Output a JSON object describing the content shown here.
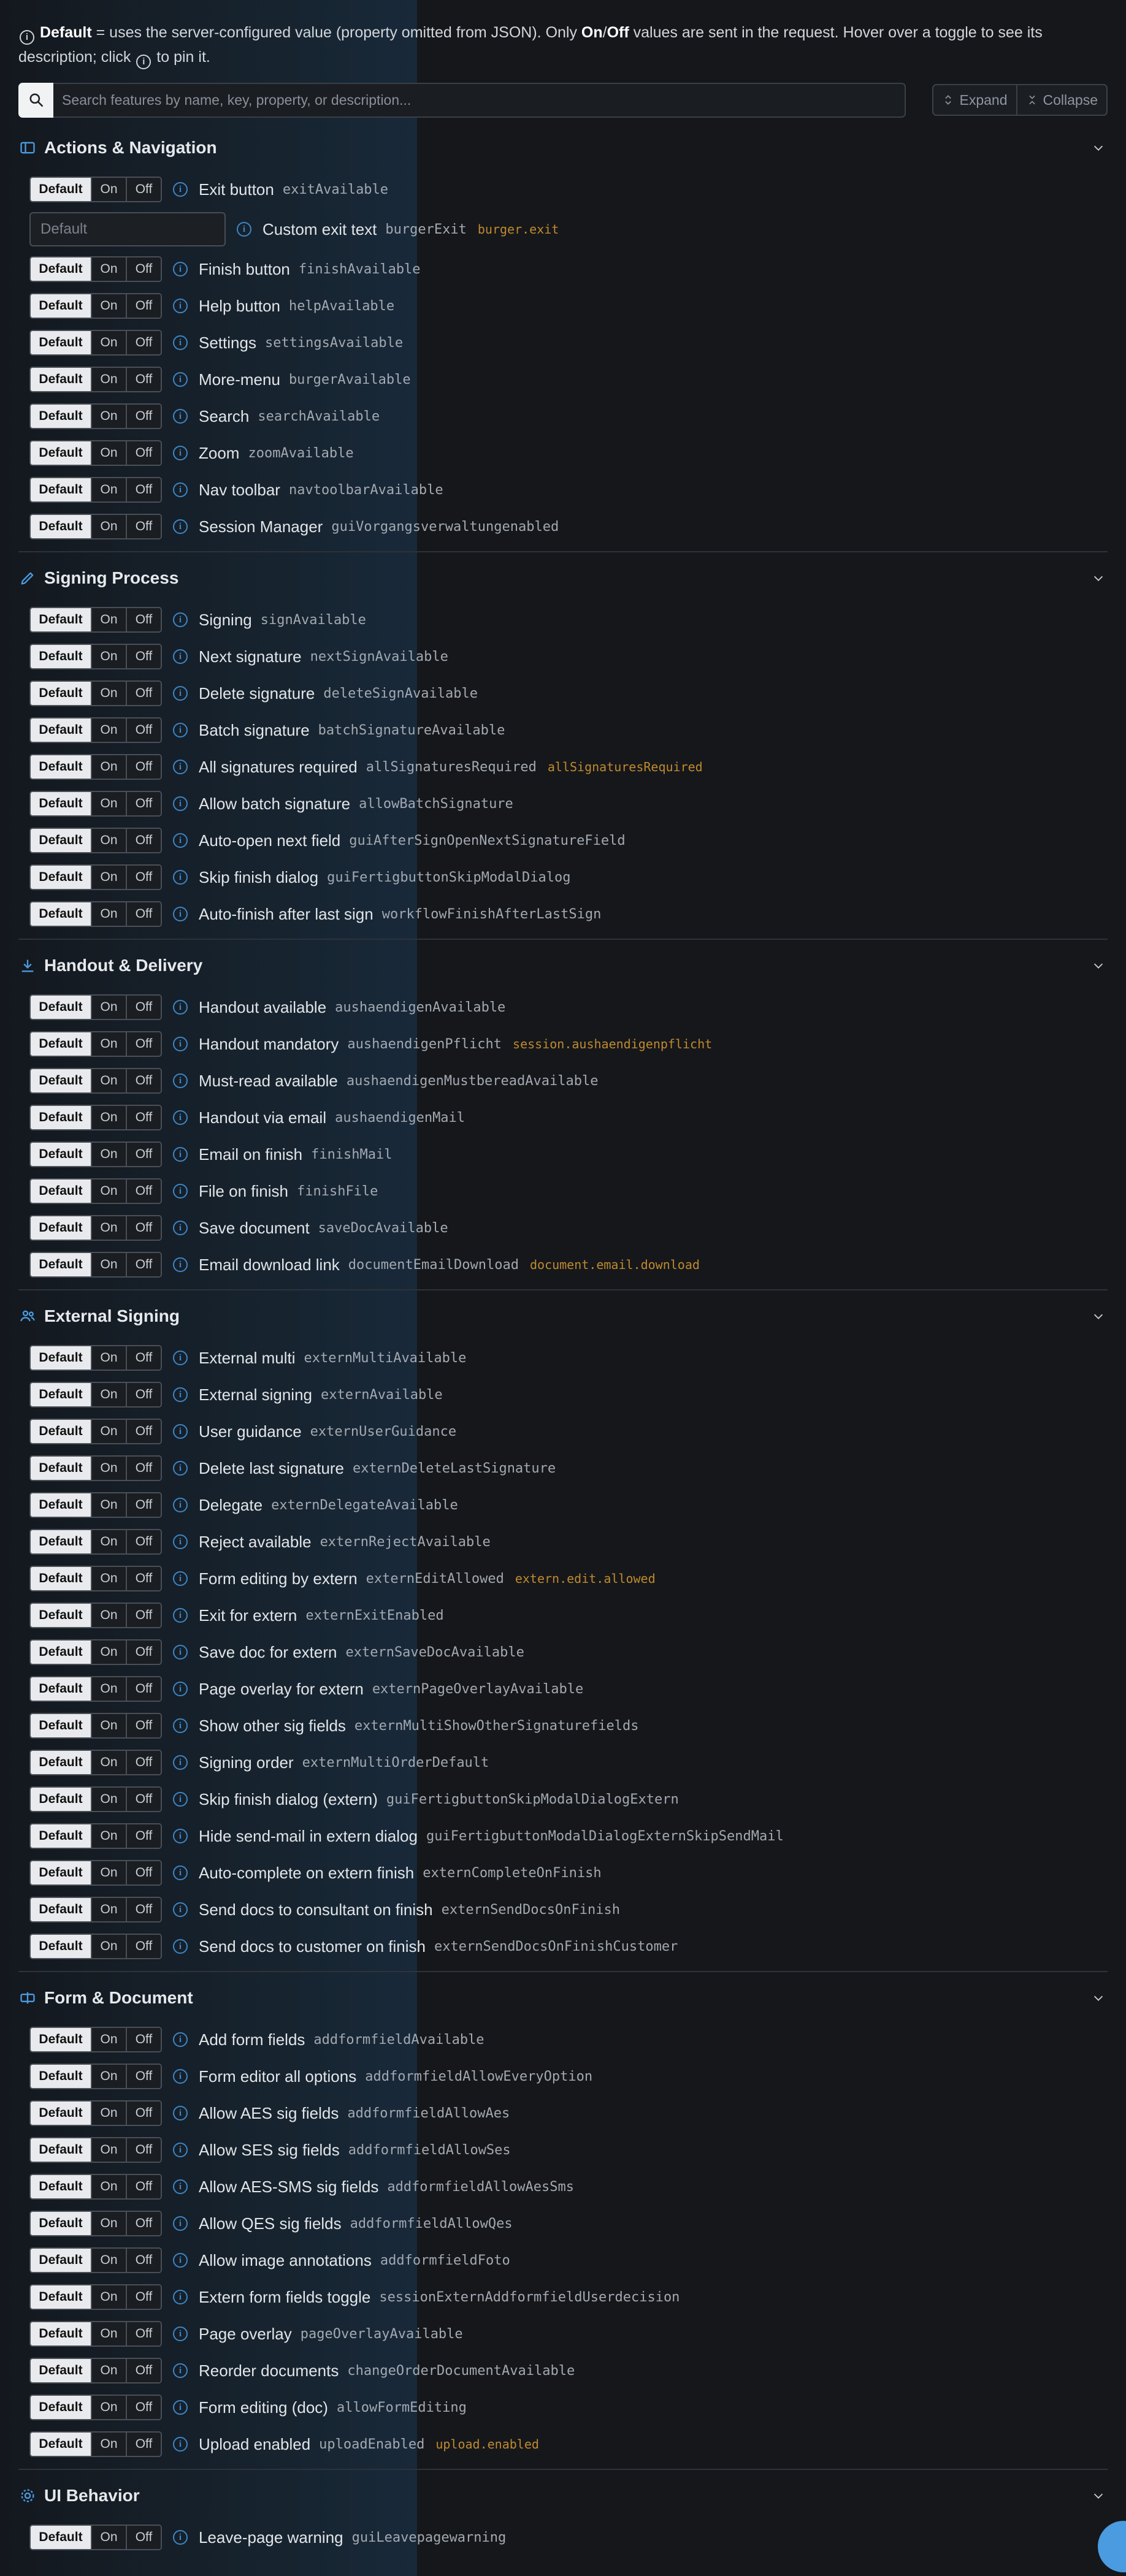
{
  "notice": {
    "default_word": "Default",
    "part1": " = uses the server-configured value (property omitted from JSON). Only ",
    "on_word": "On",
    "slash": "/",
    "off_word": "Off",
    "part2": " values are sent in the request. Hover over a toggle to see its description; click ",
    "info_glyph": "i",
    "part3": " to pin it."
  },
  "toolbar": {
    "search_placeholder": "Search features by name, key, property, or description...",
    "expand_label": "Expand",
    "collapse_label": "Collapse"
  },
  "toggle_labels": {
    "default": "Default",
    "on": "On",
    "off": "Off"
  },
  "sections": [
    {
      "title": "Actions & Navigation",
      "icon": "sidebar-panel-icon",
      "items": [
        {
          "label": "Exit button",
          "key": "exitAvailable",
          "alias": ""
        },
        {
          "label": "Custom exit text",
          "key": "burgerExit",
          "alias": "burger.exit",
          "type": "text",
          "placeholder": "Default"
        },
        {
          "label": "Finish button",
          "key": "finishAvailable",
          "alias": ""
        },
        {
          "label": "Help button",
          "key": "helpAvailable",
          "alias": ""
        },
        {
          "label": "Settings",
          "key": "settingsAvailable",
          "alias": ""
        },
        {
          "label": "More-menu",
          "key": "burgerAvailable",
          "alias": ""
        },
        {
          "label": "Search",
          "key": "searchAvailable",
          "alias": ""
        },
        {
          "label": "Zoom",
          "key": "zoomAvailable",
          "alias": ""
        },
        {
          "label": "Nav toolbar",
          "key": "navtoolbarAvailable",
          "alias": ""
        },
        {
          "label": "Session Manager",
          "key": "guiVorgangsverwaltungenabled",
          "alias": ""
        }
      ]
    },
    {
      "title": "Signing Process",
      "icon": "pen-icon",
      "items": [
        {
          "label": "Signing",
          "key": "signAvailable",
          "alias": ""
        },
        {
          "label": "Next signature",
          "key": "nextSignAvailable",
          "alias": ""
        },
        {
          "label": "Delete signature",
          "key": "deleteSignAvailable",
          "alias": ""
        },
        {
          "label": "Batch signature",
          "key": "batchSignatureAvailable",
          "alias": ""
        },
        {
          "label": "All signatures required",
          "key": "allSignaturesRequired",
          "alias": "allSignaturesRequired"
        },
        {
          "label": "Allow batch signature",
          "key": "allowBatchSignature",
          "alias": ""
        },
        {
          "label": "Auto-open next field",
          "key": "guiAfterSignOpenNextSignatureField",
          "alias": ""
        },
        {
          "label": "Skip finish dialog",
          "key": "guiFertigbuttonSkipModalDialog",
          "alias": ""
        },
        {
          "label": "Auto-finish after last sign",
          "key": "workflowFinishAfterLastSign",
          "alias": ""
        }
      ]
    },
    {
      "title": "Handout & Delivery",
      "icon": "download-icon",
      "items": [
        {
          "label": "Handout available",
          "key": "aushaendigenAvailable",
          "alias": ""
        },
        {
          "label": "Handout mandatory",
          "key": "aushaendigenPflicht",
          "alias": "session.aushaendigenpflicht"
        },
        {
          "label": "Must-read available",
          "key": "aushaendigenMustbereadAvailable",
          "alias": ""
        },
        {
          "label": "Handout via email",
          "key": "aushaendigenMail",
          "alias": ""
        },
        {
          "label": "Email on finish",
          "key": "finishMail",
          "alias": ""
        },
        {
          "label": "File on finish",
          "key": "finishFile",
          "alias": ""
        },
        {
          "label": "Save document",
          "key": "saveDocAvailable",
          "alias": ""
        },
        {
          "label": "Email download link",
          "key": "documentEmailDownload",
          "alias": "document.email.download"
        }
      ]
    },
    {
      "title": "External Signing",
      "icon": "users-icon",
      "items": [
        {
          "label": "External multi",
          "key": "externMultiAvailable",
          "alias": ""
        },
        {
          "label": "External signing",
          "key": "externAvailable",
          "alias": ""
        },
        {
          "label": "User guidance",
          "key": "externUserGuidance",
          "alias": ""
        },
        {
          "label": "Delete last signature",
          "key": "externDeleteLastSignature",
          "alias": ""
        },
        {
          "label": "Delegate",
          "key": "externDelegateAvailable",
          "alias": ""
        },
        {
          "label": "Reject available",
          "key": "externRejectAvailable",
          "alias": ""
        },
        {
          "label": "Form editing by extern",
          "key": "externEditAllowed",
          "alias": "extern.edit.allowed"
        },
        {
          "label": "Exit for extern",
          "key": "externExitEnabled",
          "alias": ""
        },
        {
          "label": "Save doc for extern",
          "key": "externSaveDocAvailable",
          "alias": ""
        },
        {
          "label": "Page overlay for extern",
          "key": "externPageOverlayAvailable",
          "alias": ""
        },
        {
          "label": "Show other sig fields",
          "key": "externMultiShowOtherSignaturefields",
          "alias": ""
        },
        {
          "label": "Signing order",
          "key": "externMultiOrderDefault",
          "alias": ""
        },
        {
          "label": "Skip finish dialog (extern)",
          "key": "guiFertigbuttonSkipModalDialogExtern",
          "alias": ""
        },
        {
          "label": "Hide send-mail in extern dialog",
          "key": "guiFertigbuttonModalDialogExternSkipSendMail",
          "alias": ""
        },
        {
          "label": "Auto-complete on extern finish",
          "key": "externCompleteOnFinish",
          "alias": ""
        },
        {
          "label": "Send docs to consultant on finish",
          "key": "externSendDocsOnFinish",
          "alias": ""
        },
        {
          "label": "Send docs to customer on finish",
          "key": "externSendDocsOnFinishCustomer",
          "alias": ""
        }
      ]
    },
    {
      "title": "Form & Document",
      "icon": "form-icon",
      "items": [
        {
          "label": "Add form fields",
          "key": "addformfieldAvailable",
          "alias": ""
        },
        {
          "label": "Form editor all options",
          "key": "addformfieldAllowEveryOption",
          "alias": ""
        },
        {
          "label": "Allow AES sig fields",
          "key": "addformfieldAllowAes",
          "alias": ""
        },
        {
          "label": "Allow SES sig fields",
          "key": "addformfieldAllowSes",
          "alias": ""
        },
        {
          "label": "Allow AES-SMS sig fields",
          "key": "addformfieldAllowAesSms",
          "alias": ""
        },
        {
          "label": "Allow QES sig fields",
          "key": "addformfieldAllowQes",
          "alias": ""
        },
        {
          "label": "Allow image annotations",
          "key": "addformfieldFoto",
          "alias": ""
        },
        {
          "label": "Extern form fields toggle",
          "key": "sessionExternAddformfieldUserdecision",
          "alias": ""
        },
        {
          "label": "Page overlay",
          "key": "pageOverlayAvailable",
          "alias": ""
        },
        {
          "label": "Reorder documents",
          "key": "changeOrderDocumentAvailable",
          "alias": ""
        },
        {
          "label": "Form editing (doc)",
          "key": "allowFormEditing",
          "alias": ""
        },
        {
          "label": "Upload enabled",
          "key": "uploadEnabled",
          "alias": "upload.enabled"
        }
      ]
    },
    {
      "title": "UI Behavior",
      "icon": "gear-icon",
      "items": [
        {
          "label": "Leave-page warning",
          "key": "guiLeavepagewarning",
          "alias": ""
        }
      ]
    }
  ]
}
